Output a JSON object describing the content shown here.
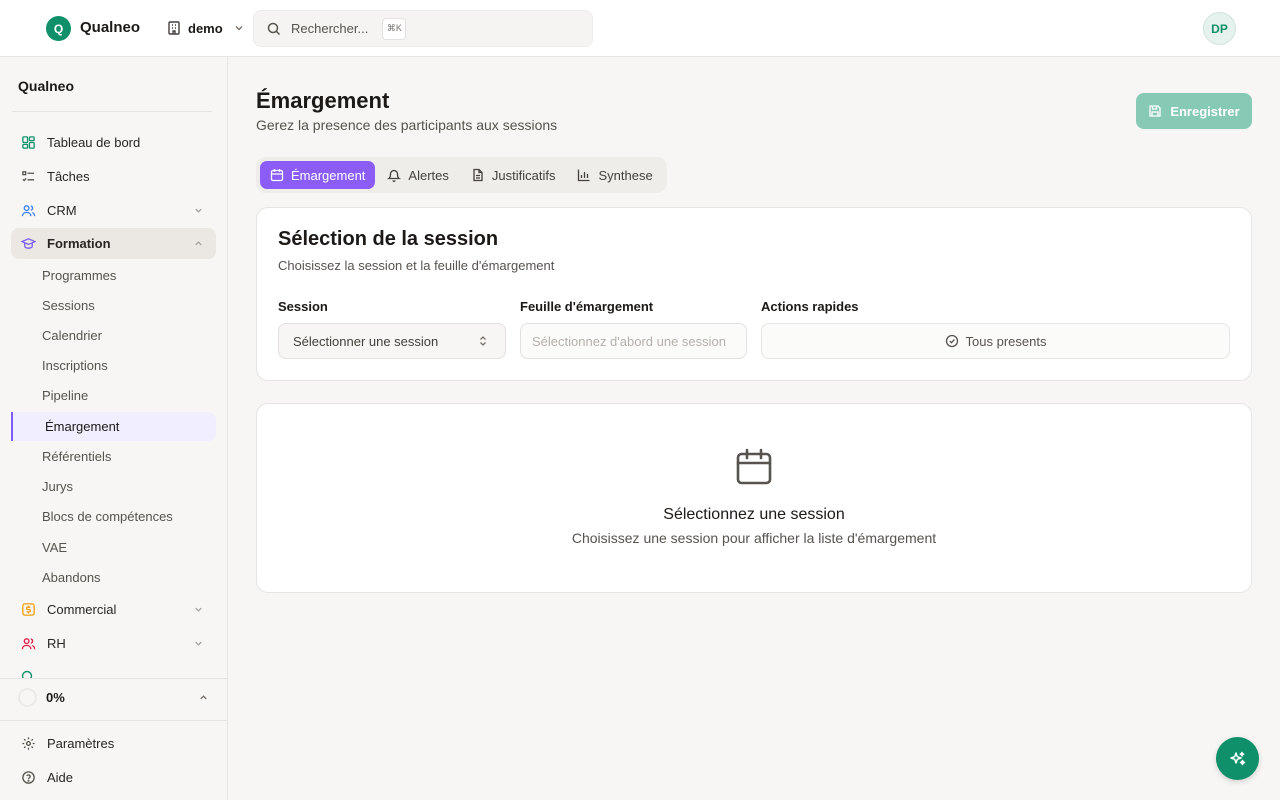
{
  "topbar": {
    "logo_letter": "Q",
    "brand": "Qualneo",
    "workspace": "demo",
    "search_placeholder": "Rechercher...",
    "search_shortcut": "⌘K",
    "avatar_initials": "DP"
  },
  "sidebar": {
    "title": "Qualneo",
    "items": [
      {
        "label": "Tableau de bord",
        "icon": "dashboard-icon"
      },
      {
        "label": "Tâches",
        "icon": "tasks-icon"
      },
      {
        "label": "CRM",
        "icon": "users-icon"
      },
      {
        "label": "Formation",
        "icon": "graduation-cap-icon"
      },
      {
        "label": "Commercial",
        "icon": "dollar-icon"
      },
      {
        "label": "RH",
        "icon": "people-icon"
      }
    ],
    "formation_sub": [
      "Programmes",
      "Sessions",
      "Calendrier",
      "Inscriptions",
      "Pipeline",
      "Émargement",
      "Référentiels",
      "Jurys",
      "Blocs de compétences",
      "VAE",
      "Abandons"
    ],
    "progress": "0%",
    "bottom_items": [
      {
        "label": "Paramètres",
        "icon": "gear-icon"
      },
      {
        "label": "Aide",
        "icon": "help-icon"
      }
    ]
  },
  "main": {
    "title": "Émargement",
    "subtitle": "Gerez la presence des participants aux sessions",
    "save_label": "Enregistrer",
    "tabs": [
      {
        "label": "Émargement",
        "icon": "calendar-icon"
      },
      {
        "label": "Alertes",
        "icon": "bell-icon"
      },
      {
        "label": "Justificatifs",
        "icon": "document-icon"
      },
      {
        "label": "Synthese",
        "icon": "bar-chart-icon"
      }
    ],
    "selection_card": {
      "title": "Sélection de la session",
      "subtitle": "Choisissez la session et la feuille d'émargement",
      "session_label": "Session",
      "session_placeholder": "Sélectionner une session",
      "sheet_label": "Feuille d'émargement",
      "sheet_placeholder": "Sélectionnez d'abord une session",
      "actions_label": "Actions rapides",
      "all_present_label": "Tous presents"
    },
    "empty_card": {
      "title": "Sélectionnez une session",
      "subtitle": "Choisissez une session pour afficher la liste d'émargement"
    }
  },
  "colors": {
    "brand": "#10906a",
    "accent": "#8b5cf6",
    "save_disabled": "#86c9b5"
  }
}
